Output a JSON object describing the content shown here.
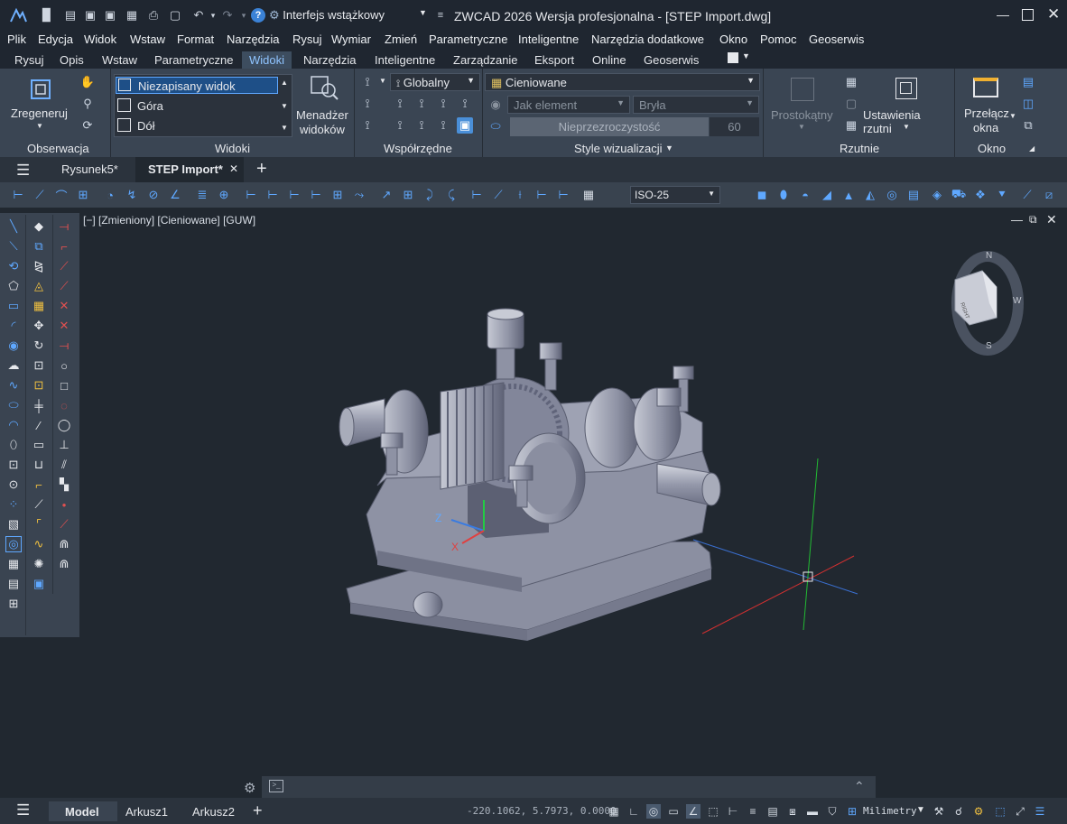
{
  "title_bar": {
    "workspace": "Interfejs wstążkowy",
    "title": "ZWCAD 2026 Wersja profesjonalna - [STEP Import.dwg]"
  },
  "menu": [
    "Plik",
    "Edycja",
    "Widok",
    "Wstaw",
    "Format",
    "Narzędzia",
    "Rysuj",
    "Wymiar",
    "Zmień",
    "Parametryczne",
    "Inteligentne",
    "Narzędzia dodatkowe",
    "Okno",
    "Pomoc",
    "Geoserwis"
  ],
  "ribbon_tabs": [
    "Rysuj",
    "Opis",
    "Wstaw",
    "Parametryczne",
    "Widoki",
    "Narzędzia",
    "Inteligentne",
    "Zarządzanie",
    "Eksport",
    "Online",
    "Geoserwis"
  ],
  "ribbon": {
    "observation": {
      "regen_label": "Zregeneruj",
      "panel_label": "Obserwacja"
    },
    "views": {
      "items": [
        "Niezapisany widok",
        "Góra",
        "Dół"
      ],
      "manager_line1": "Menadżer",
      "manager_line2": "widoków",
      "panel_label": "Widoki"
    },
    "coords": {
      "ucs": "Globalny",
      "panel_label": "Współrzędne"
    },
    "visual_styles": {
      "style": "Cieniowane",
      "layer": "Jak element",
      "material": "Bryła",
      "transparency_label": "Nieprzezroczystość",
      "transparency_value": "60",
      "panel_label": "Style wizualizacji"
    },
    "viewports": {
      "rect_label": "Prostokątny",
      "settings_label": "Ustawienia rzutni",
      "panel_label": "Rzutnie"
    },
    "window": {
      "switch_line1": "Przełącz",
      "switch_line2": "okna",
      "panel_label": "Okno"
    }
  },
  "doc_tabs": [
    "Rysunek5*",
    "STEP Import*"
  ],
  "dimstyle": "ISO-25",
  "viewport": {
    "label": "[−] [Zmieniony] [Cieniowane] [GUW]"
  },
  "viewcube": {
    "face": "RIGHT",
    "compass": [
      "N",
      "W",
      "S"
    ]
  },
  "layout_tabs": [
    "Model",
    "Arkusz1",
    "Arkusz2"
  ],
  "status": {
    "coords": "-220.1062, 5.7973, 0.0000",
    "units": "Milimetry"
  },
  "colors": {
    "accent": "#5fa8ff",
    "ribbon": "#3a4553",
    "bg": "#212830",
    "model_grey": "#8e92a4"
  }
}
